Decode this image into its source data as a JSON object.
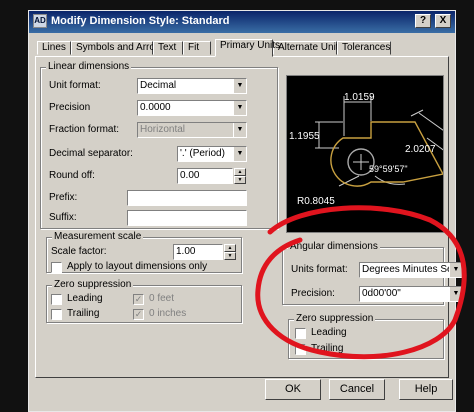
{
  "window": {
    "title": "Modify Dimension Style: Standard",
    "help_label": "?",
    "close_label": "X",
    "app_icon_text": "AD"
  },
  "tabs": [
    {
      "label": "Lines"
    },
    {
      "label": "Symbols and Arrows"
    },
    {
      "label": "Text"
    },
    {
      "label": "Fit"
    },
    {
      "label": "Primary Units"
    },
    {
      "label": "Alternate Units"
    },
    {
      "label": "Tolerances"
    }
  ],
  "linear": {
    "legend": "Linear dimensions",
    "unit_format": {
      "label": "Unit format:",
      "value": "Decimal"
    },
    "precision": {
      "label": "Precision",
      "value": "0.0000"
    },
    "fraction_format": {
      "label": "Fraction format:",
      "value": "Horizontal"
    },
    "decimal_separator": {
      "label": "Decimal separator:",
      "value": "'.' (Period)"
    },
    "round_off": {
      "label": "Round off:",
      "value": "0.00"
    },
    "prefix": {
      "label": "Prefix:",
      "value": ""
    },
    "suffix": {
      "label": "Suffix:",
      "value": ""
    }
  },
  "measurement": {
    "legend": "Measurement scale",
    "scale_factor": {
      "label": "Scale factor:",
      "value": "1.00"
    },
    "apply_layout": {
      "label": "Apply to layout dimensions only"
    }
  },
  "zero_linear": {
    "legend": "Zero suppression",
    "leading": "Leading",
    "trailing": "Trailing",
    "feet": "0 feet",
    "inches": "0 inches"
  },
  "preview": {
    "dim_top": "1.0159",
    "dim_left": "1.1955",
    "dim_right": "2.0207",
    "dim_radius": "R0.8045",
    "dim_angle": "59°59'57\""
  },
  "angular": {
    "legend": "Angular dimensions",
    "units_format": {
      "label": "Units format:",
      "value": "Degrees Minutes Seconds"
    },
    "precision": {
      "label": "Precision:",
      "value": "0d00'00\""
    }
  },
  "zero_angular": {
    "legend": "Zero suppression",
    "leading": "Leading",
    "trailing": "Trailing"
  },
  "buttons": {
    "ok": "OK",
    "cancel": "Cancel",
    "help": "Help"
  },
  "colors": {
    "annotation": "#e0141e",
    "dialog_bg": "#d4d0c8",
    "title_bar": "#0a246a"
  }
}
